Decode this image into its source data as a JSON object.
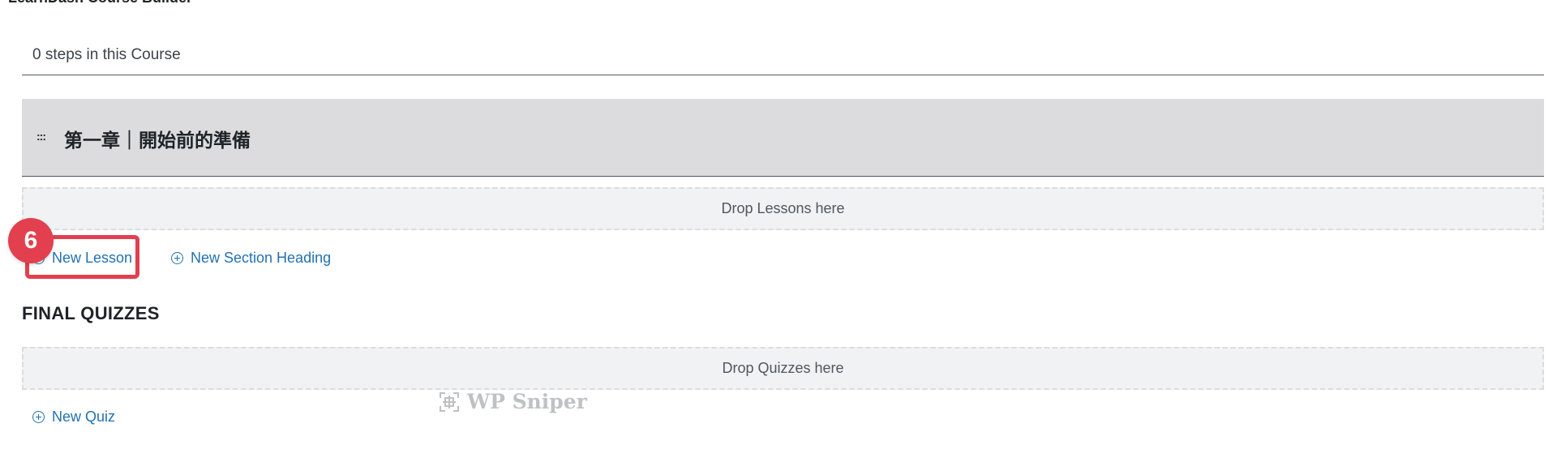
{
  "panel": {
    "title": "LearnDash Course Builder",
    "steps_summary": "0 steps in this Course"
  },
  "section": {
    "drag_handle": ":::",
    "title": "第一章｜開始前的準備"
  },
  "lessons": {
    "dropzone_label": "Drop Lessons here",
    "new_lesson_label": "New Lesson",
    "new_section_label": "New Section Heading"
  },
  "annotation": {
    "step_number": "6",
    "accent_color": "#e2404f"
  },
  "final_quizzes": {
    "heading": "FINAL QUIZZES",
    "dropzone_label": "Drop Quizzes here",
    "new_quiz_label": "New Quiz"
  },
  "watermark": {
    "text": "WP Sniper",
    "icon": "wp-sniper-logo-icon"
  },
  "colors": {
    "link": "#2271b1",
    "section_bg": "#dcdcde",
    "dropzone_bg": "#f1f2f3"
  }
}
